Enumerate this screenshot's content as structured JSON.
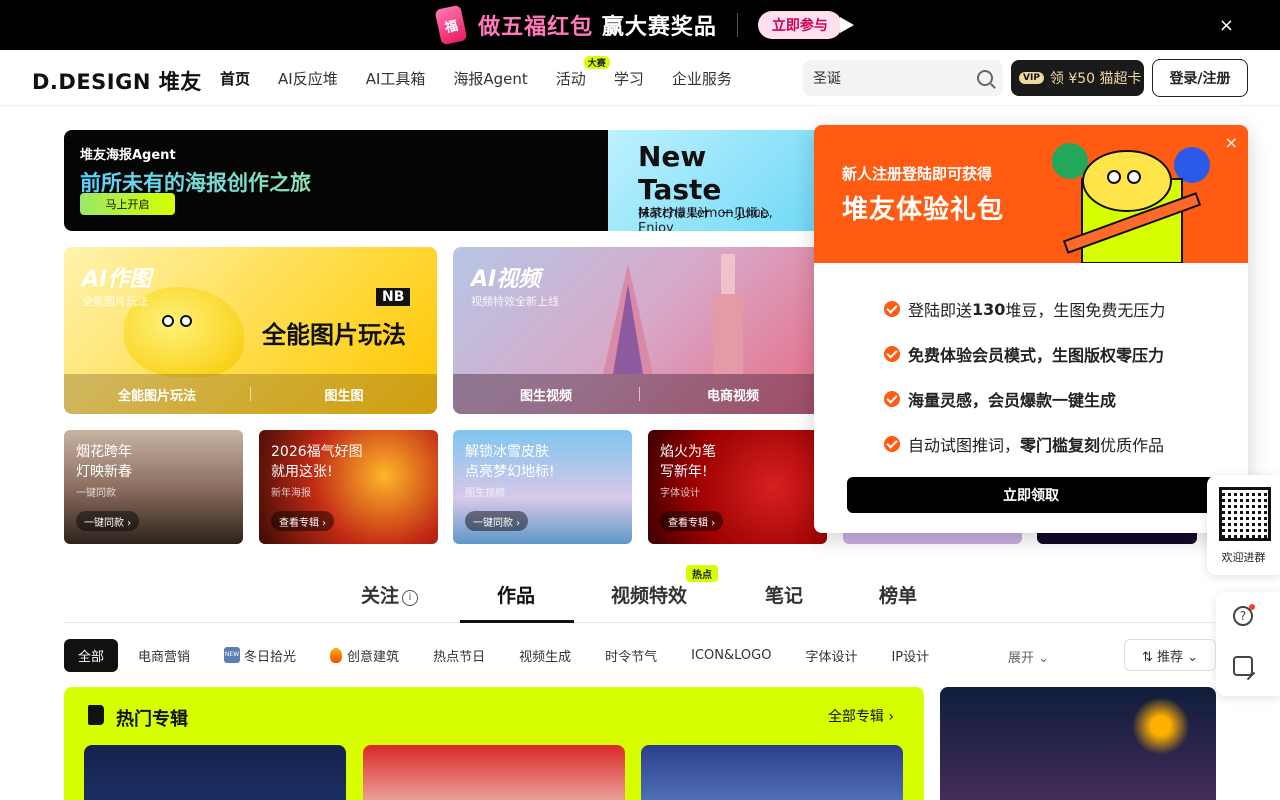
{
  "promo": {
    "icon_text": "福",
    "text_pink": "做五福红包",
    "text_white": "赢大赛奖品",
    "button": "立即参与",
    "close": "×"
  },
  "nav": {
    "logo": "D.DESIGN 堆友",
    "items": [
      {
        "label": "首页",
        "active": true
      },
      {
        "label": "AI反应堆"
      },
      {
        "label": "AI工具箱"
      },
      {
        "label": "海报Agent"
      },
      {
        "label": "活动",
        "badge": "大赛"
      },
      {
        "label": "学习"
      },
      {
        "label": "企业服务"
      }
    ],
    "search_value": "圣诞",
    "vip_tag": "VIP",
    "vip_label": "领 ¥50 猫超卡",
    "login": "登录/注册"
  },
  "hero": {
    "small": "堆友海报Agent",
    "big": "前所未有的海报创作之旅",
    "button": "马上开启",
    "right_title": "New Taste",
    "right_sub": "Matcha Lemon Juice, Enjoy",
    "right_cn": "抹茶柠檬果汁 · 一见倾心"
  },
  "features": [
    {
      "title": "AI作图",
      "sub": "全能图片玩法",
      "big": "全能图片玩法",
      "tag": "NB",
      "links": [
        "全能图片玩法",
        "图生图"
      ]
    },
    {
      "title": "AI视频",
      "sub": "视频特效全新上线",
      "links": [
        "图生视频",
        "电商视频"
      ]
    }
  ],
  "templates": [
    {
      "line1": "烟花跨年",
      "line2": "灯映新春",
      "sub": "一键同款",
      "button": "一键同款 ›"
    },
    {
      "line1": "2026福气好图",
      "line2": "就用这张!",
      "sub": "新年海报",
      "button": "查看专辑 ›"
    },
    {
      "line1": "解锁冰雪皮肤",
      "line2": "点亮梦幻地标!",
      "sub": "图生视频",
      "button": "一键同款 ›"
    },
    {
      "line1": "焰火为笔",
      "line2": "写新年!",
      "sub": "字体设计",
      "button": "查看专辑 ›"
    }
  ],
  "popup": {
    "small": "新人注册登陆即可获得",
    "big": "堆友体验礼包",
    "close": "×",
    "items": [
      {
        "pre": "登陆即送",
        "bold": "130",
        "post": "堆豆，生图免费无压力"
      },
      {
        "pre": "",
        "bold": "免费体验会员模式，生图版权零压力",
        "post": ""
      },
      {
        "pre": "",
        "bold": "海量灵感，会员爆款一键生成",
        "post": ""
      },
      {
        "pre": "自动试图推词，",
        "bold": "零门槛复刻",
        "post": "优质作品"
      }
    ],
    "button": "立即领取"
  },
  "side": {
    "qr_label": "欢迎进群",
    "help": "?"
  },
  "tabs": {
    "items": [
      {
        "label": "关注",
        "info": "i"
      },
      {
        "label": "作品",
        "active": true
      },
      {
        "label": "视频特效",
        "badge": "热点"
      },
      {
        "label": "笔记"
      },
      {
        "label": "榜单"
      }
    ]
  },
  "chips": {
    "items": [
      {
        "label": "全部",
        "active": true
      },
      {
        "label": "电商营销"
      },
      {
        "label": "冬日拾光",
        "icon": "new-icon",
        "icon_text": "NEW"
      },
      {
        "label": "创意建筑",
        "icon": "fire-icon"
      },
      {
        "label": "热点节日"
      },
      {
        "label": "视频生成"
      },
      {
        "label": "时令节气"
      },
      {
        "label": "ICON&LOGO"
      },
      {
        "label": "字体设计"
      },
      {
        "label": "IP设计"
      }
    ],
    "expand": "展开 ⌄",
    "sort": "⇅ 推荐 ⌄"
  },
  "albums": {
    "title": "热门专辑",
    "all": "全部专辑 ›"
  },
  "colors": {
    "accent": "#d7ff00",
    "orange": "#ff5b12",
    "black": "#000000"
  }
}
